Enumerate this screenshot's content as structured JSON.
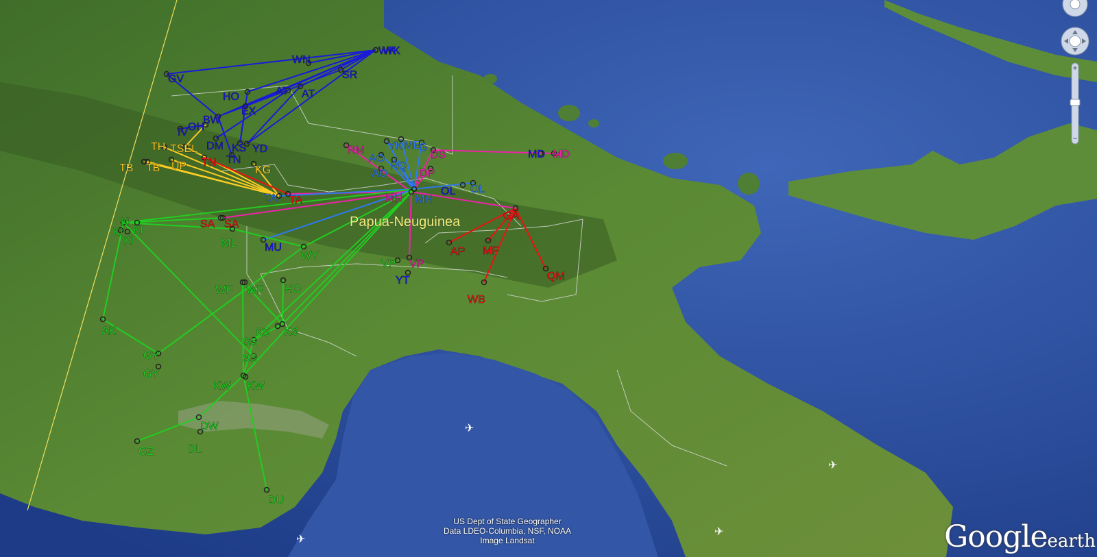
{
  "map": {
    "country_label": "Papua-Neuguinea",
    "country_label_color": "#f3f07a",
    "sea_color": "#2a4e9e",
    "land_color": "#4a7a2e"
  },
  "group_colors": {
    "blue": "#1a1ad8",
    "yellow": "#ffcc22",
    "red": "#ee1111",
    "magenta": "#ee22aa",
    "lightblue": "#2f78f0",
    "green": "#22cc22"
  },
  "sites": [
    {
      "id": "wk1",
      "label": "WK",
      "group": "blue"
    },
    {
      "id": "wk2",
      "label": "WK",
      "group": "blue"
    },
    {
      "id": "wn",
      "label": "WN",
      "group": "blue"
    },
    {
      "id": "sr",
      "label": "SR",
      "group": "blue"
    },
    {
      "id": "gv",
      "label": "GV",
      "group": "blue"
    },
    {
      "id": "ho1",
      "label": "HO",
      "group": "blue"
    },
    {
      "id": "at1",
      "label": "AT",
      "group": "blue"
    },
    {
      "id": "at2",
      "label": "AT",
      "group": "blue"
    },
    {
      "id": "ex",
      "label": "EX",
      "group": "blue"
    },
    {
      "id": "bw",
      "label": "BW",
      "group": "blue"
    },
    {
      "id": "oh",
      "label": "OH",
      "group": "blue"
    },
    {
      "id": "iv",
      "label": "IV",
      "group": "blue"
    },
    {
      "id": "dm",
      "label": "DM",
      "group": "blue"
    },
    {
      "id": "ks1",
      "label": "KS",
      "group": "blue"
    },
    {
      "id": "yd",
      "label": "YD",
      "group": "blue"
    },
    {
      "id": "th",
      "label": "TH",
      "group": "yellow"
    },
    {
      "id": "tb1",
      "label": "TB",
      "group": "yellow"
    },
    {
      "id": "tb2",
      "label": "TB",
      "group": "yellow"
    },
    {
      "id": "up",
      "label": "UP",
      "group": "yellow"
    },
    {
      "id": "tsel",
      "label": "TSEL",
      "group": "yellow"
    },
    {
      "id": "kg",
      "label": "KG",
      "group": "yellow"
    },
    {
      "id": "tn1",
      "label": "TN",
      "group": "red"
    },
    {
      "id": "tn2",
      "label": "TN",
      "group": "blue"
    },
    {
      "id": "ta1",
      "label": "TA",
      "group": "lightblue"
    },
    {
      "id": "ta2",
      "label": "TA",
      "group": "red"
    },
    {
      "id": "rm",
      "label": "RM",
      "group": "magenta"
    },
    {
      "id": "yk",
      "label": "YK",
      "group": "lightblue"
    },
    {
      "id": "me",
      "label": "ME",
      "group": "lightblue"
    },
    {
      "id": "gg",
      "label": "G",
      "group": "lightblue"
    },
    {
      "id": "ds",
      "label": "DS",
      "group": "magenta"
    },
    {
      "id": "ao1",
      "label": "AO",
      "group": "lightblue"
    },
    {
      "id": "ao2",
      "label": "AO",
      "group": "lightblue"
    },
    {
      "id": "rq",
      "label": "RQ",
      "group": "lightblue"
    },
    {
      "id": "dp",
      "label": "DP",
      "group": "magenta"
    },
    {
      "id": "md1",
      "label": "MD",
      "group": "blue"
    },
    {
      "id": "md2",
      "label": "MD",
      "group": "magenta"
    },
    {
      "id": "mh1",
      "label": "MH",
      "group": "magenta"
    },
    {
      "id": "mh2",
      "label": "MH",
      "group": "lightblue"
    },
    {
      "id": "ol1",
      "label": "OL",
      "group": "blue"
    },
    {
      "id": "ol2",
      "label": "OL",
      "group": "lightblue"
    },
    {
      "id": "ga",
      "label": "GA",
      "group": "red"
    },
    {
      "id": "ap",
      "label": "AP",
      "group": "red"
    },
    {
      "id": "mf",
      "label": "MF",
      "group": "red"
    },
    {
      "id": "qm",
      "label": "QM",
      "group": "red"
    },
    {
      "id": "wb",
      "label": "WB",
      "group": "red"
    },
    {
      "id": "vp1",
      "label": "VP",
      "group": "green"
    },
    {
      "id": "vp2",
      "label": "VP",
      "group": "magenta"
    },
    {
      "id": "yt",
      "label": "YT",
      "group": "blue"
    },
    {
      "id": "sa1",
      "label": "SA",
      "group": "red"
    },
    {
      "id": "sa2",
      "label": "SA",
      "group": "red"
    },
    {
      "id": "ml",
      "label": "ML",
      "group": "green"
    },
    {
      "id": "mu",
      "label": "MU",
      "group": "blue"
    },
    {
      "id": "wy",
      "label": "WY",
      "group": "green"
    },
    {
      "id": "ki1",
      "label": "KI",
      "group": "green"
    },
    {
      "id": "ki2",
      "label": "KI",
      "group": "green"
    },
    {
      "id": "ki3",
      "label": "KI",
      "group": "green"
    },
    {
      "id": "ki4",
      "label": "KI",
      "group": "green"
    },
    {
      "id": "wf1",
      "label": "WF",
      "group": "green"
    },
    {
      "id": "wf2",
      "label": "WF",
      "group": "green"
    },
    {
      "id": "ho2",
      "label": "HO",
      "group": "green"
    },
    {
      "id": "ak",
      "label": "AK",
      "group": "green"
    },
    {
      "id": "ks2",
      "label": "KS",
      "group": "green"
    },
    {
      "id": "ks3",
      "label": "KS",
      "group": "green"
    },
    {
      "id": "ss1",
      "label": "SS",
      "group": "green"
    },
    {
      "id": "ss2",
      "label": "SS",
      "group": "green"
    },
    {
      "id": "gy1",
      "label": "GY",
      "group": "green"
    },
    {
      "id": "gy2",
      "label": "GY",
      "group": "green"
    },
    {
      "id": "kw1",
      "label": "KW",
      "group": "green"
    },
    {
      "id": "kw2",
      "label": "KW",
      "group": "green"
    },
    {
      "id": "dw",
      "label": "DW",
      "group": "green"
    },
    {
      "id": "dl",
      "label": "DL",
      "group": "green"
    },
    {
      "id": "gz",
      "label": "GZ",
      "group": "green"
    },
    {
      "id": "du",
      "label": "DU",
      "group": "green"
    }
  ],
  "links": [
    {
      "from": "wk1",
      "to": "gv",
      "group": "blue"
    },
    {
      "from": "wk1",
      "to": "bw",
      "group": "blue"
    },
    {
      "from": "wk1",
      "to": "ex",
      "group": "blue"
    },
    {
      "from": "wk1",
      "to": "at2",
      "group": "blue"
    },
    {
      "from": "wk1",
      "to": "yd",
      "group": "blue"
    },
    {
      "from": "wk1",
      "to": "ho1",
      "group": "blue"
    },
    {
      "from": "wk2",
      "to": "sr",
      "group": "blue"
    },
    {
      "from": "wk2",
      "to": "wn",
      "group": "blue"
    },
    {
      "from": "gv",
      "to": "bw",
      "group": "blue"
    },
    {
      "from": "ho1",
      "to": "ks1",
      "group": "blue"
    },
    {
      "from": "ex",
      "to": "bw",
      "group": "blue"
    },
    {
      "from": "at1",
      "to": "dm",
      "group": "blue"
    },
    {
      "from": "sr",
      "to": "ex",
      "group": "blue"
    },
    {
      "from": "ex",
      "to": "ks1",
      "group": "blue"
    },
    {
      "from": "bw",
      "to": "tn2",
      "group": "blue"
    },
    {
      "from": "at2",
      "to": "yd",
      "group": "blue"
    },
    {
      "from": "oh",
      "to": "iv",
      "group": "blue"
    },
    {
      "from": "th",
      "to": "ta1",
      "group": "yellow"
    },
    {
      "from": "tb1",
      "to": "ta1",
      "group": "yellow"
    },
    {
      "from": "tb2",
      "to": "ta1",
      "group": "yellow"
    },
    {
      "from": "up",
      "to": "ta1",
      "group": "yellow"
    },
    {
      "from": "tsel",
      "to": "ta1",
      "group": "yellow"
    },
    {
      "from": "kg",
      "to": "ta1",
      "group": "yellow"
    },
    {
      "from": "oh",
      "to": "tsel",
      "group": "yellow"
    },
    {
      "from": "tn1",
      "to": "ta2",
      "group": "red"
    },
    {
      "from": "ga",
      "to": "ap",
      "group": "red"
    },
    {
      "from": "ga",
      "to": "mf",
      "group": "red"
    },
    {
      "from": "ga",
      "to": "qm",
      "group": "red"
    },
    {
      "from": "ga",
      "to": "wb",
      "group": "red"
    },
    {
      "from": "mh1",
      "to": "rm",
      "group": "magenta"
    },
    {
      "from": "mh1",
      "to": "ds",
      "group": "magenta"
    },
    {
      "from": "mh1",
      "to": "dp",
      "group": "magenta"
    },
    {
      "from": "mh1",
      "to": "ga",
      "group": "magenta"
    },
    {
      "from": "mh1",
      "to": "vp2",
      "group": "magenta"
    },
    {
      "from": "mh1",
      "to": "sa2",
      "group": "magenta"
    },
    {
      "from": "ds",
      "to": "md2",
      "group": "magenta"
    },
    {
      "from": "mh1",
      "to": "ta2",
      "group": "magenta"
    },
    {
      "from": "mh2",
      "to": "yk",
      "group": "lightblue"
    },
    {
      "from": "mh2",
      "to": "me",
      "group": "lightblue"
    },
    {
      "from": "mh2",
      "to": "ao1",
      "group": "lightblue"
    },
    {
      "from": "mh2",
      "to": "rq",
      "group": "lightblue"
    },
    {
      "from": "mh2",
      "to": "ol2",
      "group": "lightblue"
    },
    {
      "from": "mh2",
      "to": "ta1",
      "group": "lightblue"
    },
    {
      "from": "mh2",
      "to": "mu",
      "group": "lightblue"
    },
    {
      "from": "mh2",
      "to": "gg",
      "group": "lightblue"
    },
    {
      "from": "mh2",
      "to": "ki1",
      "group": "green"
    },
    {
      "from": "mh2",
      "to": "wy",
      "group": "green"
    },
    {
      "from": "mh2",
      "to": "ks2",
      "group": "green"
    },
    {
      "from": "mh2",
      "to": "ss1",
      "group": "green"
    },
    {
      "from": "mh2",
      "to": "kw1",
      "group": "green"
    },
    {
      "from": "ki1",
      "to": "sa2",
      "group": "green"
    },
    {
      "from": "ki1",
      "to": "ml",
      "group": "green"
    },
    {
      "from": "ki1",
      "to": "ak",
      "group": "green"
    },
    {
      "from": "ki1",
      "to": "ss2",
      "group": "green"
    },
    {
      "from": "ml",
      "to": "wy",
      "group": "green"
    },
    {
      "from": "wf1",
      "to": "ks2",
      "group": "green"
    },
    {
      "from": "wf1",
      "to": "kw1",
      "group": "green"
    },
    {
      "from": "ak",
      "to": "gy1",
      "group": "green"
    },
    {
      "from": "gy1",
      "to": "wy",
      "group": "green"
    },
    {
      "from": "ss1",
      "to": "kw1",
      "group": "green"
    },
    {
      "from": "kw1",
      "to": "dw",
      "group": "green"
    },
    {
      "from": "dw",
      "to": "gz",
      "group": "green"
    },
    {
      "from": "kw1",
      "to": "du",
      "group": "green"
    },
    {
      "from": "ho2",
      "to": "ks2",
      "group": "green"
    },
    {
      "from": "ks2",
      "to": "ss1",
      "group": "green"
    }
  ],
  "credits": {
    "line1": "US Dept of State Geographer",
    "line2": "Data LDEO-Columbia, NSF, NOAA",
    "line3": "Image Landsat"
  },
  "logo": {
    "google": "Google",
    "earth": "earth"
  },
  "nav_controls": {
    "look_icon": "eye-icon",
    "move_icon": "move-arrows-icon",
    "zoom_in": "+",
    "zoom_out": "−"
  }
}
